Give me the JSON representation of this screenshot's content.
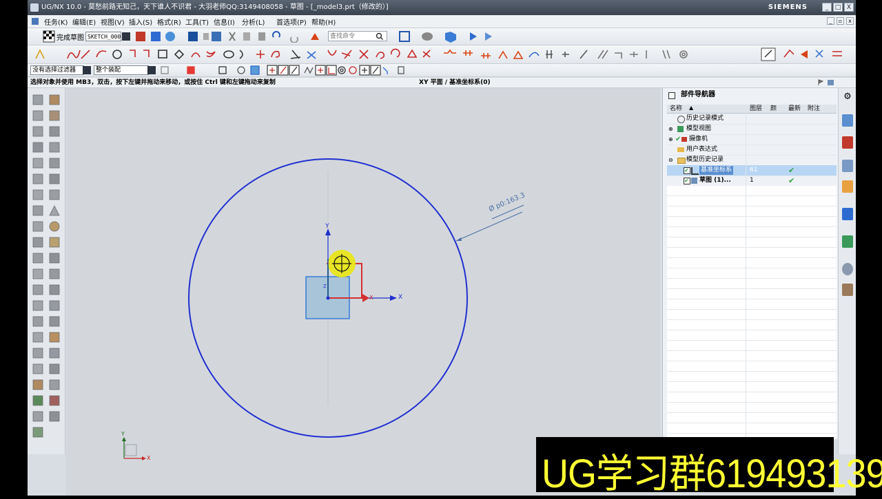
{
  "window": {
    "title": "UG/NX 10.0 - 莫愁前路无知己，天下谁人不识君 - 大羽老师QQ:3149408058 - 草图 - [_model3.prt（修改的）]",
    "brand": "SIEMENS",
    "buttons": [
      "_",
      "□",
      "X"
    ]
  },
  "menu": {
    "items": [
      "任务(K)",
      "编辑(E)",
      "视图(V)",
      "插入(S)",
      "格式(R)",
      "工具(T)",
      "信息(I)",
      "分析(L)",
      "首选项(P)",
      "帮助(H)"
    ]
  },
  "toolbar1": {
    "finish_sketch": "完成草图",
    "sketch_name": "SKETCH_000",
    "search_placeholder": "查找命令"
  },
  "selection_bar": {
    "filter": "没有选择过滤器",
    "scope": "整个装配"
  },
  "status": {
    "prompt": "选择对象并使用 MB3，双击，按下左键并拖动来移动，或按住 Ctrl 键和左键拖动来复制",
    "plane": "XY 平面 / 基准坐标系(0)"
  },
  "canvas": {
    "dimension_label": "Ø p0:163.3",
    "axis_x": "X",
    "axis_y": "Y",
    "triad_x": "X",
    "triad_y": "Y",
    "small_axis": "Z"
  },
  "part_navigator": {
    "title": "部件导航器",
    "columns": [
      "名称",
      "图层",
      "颜",
      "最新",
      "附注"
    ],
    "rows": [
      {
        "label": "历史记录模式",
        "layer": "",
        "latest": false
      },
      {
        "label": "模型视图",
        "layer": "",
        "latest": false
      },
      {
        "label": "摄像机",
        "layer": "",
        "latest": false
      },
      {
        "label": "用户表达式",
        "layer": "",
        "latest": false
      },
      {
        "label": "模型历史记录",
        "layer": "",
        "latest": false
      },
      {
        "label": "基准坐标系",
        "layer": "61",
        "latest": true
      },
      {
        "label": "草图 (1)...",
        "layer": "1",
        "latest": true
      }
    ]
  },
  "overlay": {
    "text": "UG学习群619493139"
  },
  "colors": {
    "sketch_blue": "#1f2fd0",
    "highlight": "#e8e61a",
    "selected_row": "#b8d6f4",
    "overlay_text": "#ffff33"
  }
}
